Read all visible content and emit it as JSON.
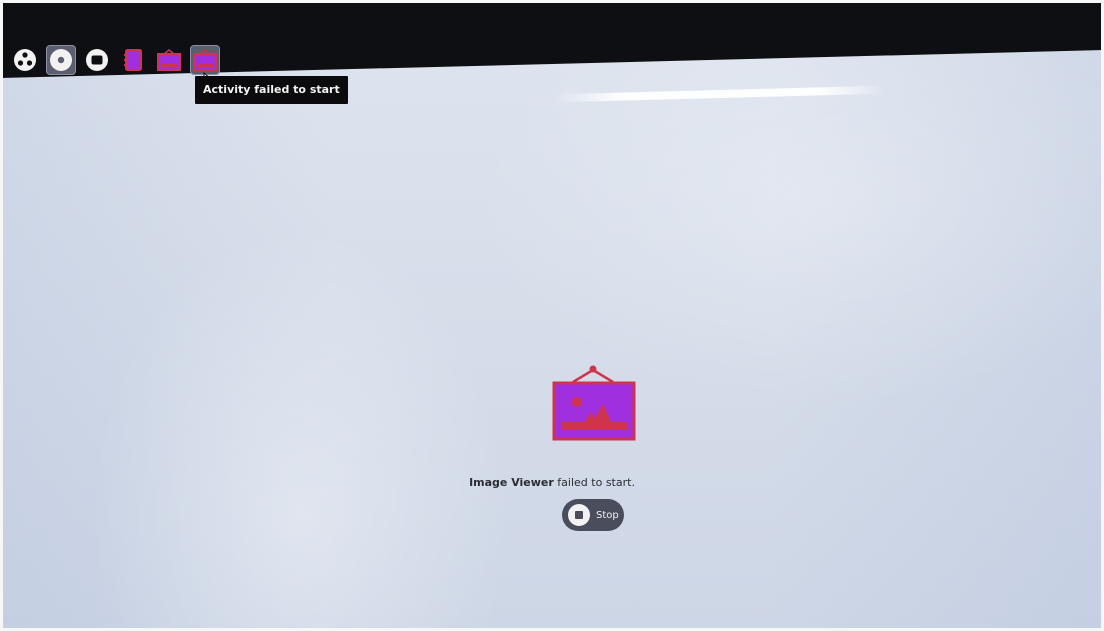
{
  "toolbar": {
    "items": [
      {
        "name": "neighborhood-view",
        "icon": "neighborhood-icon",
        "selected": false
      },
      {
        "name": "group-view",
        "icon": "group-icon",
        "selected": true
      },
      {
        "name": "home-view",
        "icon": "home-icon",
        "selected": false
      },
      {
        "name": "activity-write",
        "icon": "write-activity-icon",
        "selected": false
      },
      {
        "name": "activity-image-viewer",
        "icon": "image-viewer-icon",
        "selected": false
      },
      {
        "name": "activity-image-viewer-current",
        "icon": "image-viewer-icon",
        "selected": true
      }
    ],
    "tooltip": "Activity failed to start"
  },
  "main": {
    "activity_icon": "image-viewer-icon",
    "message_bold": "Image Viewer",
    "message_rest": " failed to start.",
    "stop_label": "Stop"
  },
  "colors": {
    "frame_bar": "#0e0f12",
    "desktop_bg": "#d8dfeb",
    "activity_stroke": "#d0344a",
    "activity_fill": "#a02fe0",
    "button_bg": "#4a4d5c"
  }
}
